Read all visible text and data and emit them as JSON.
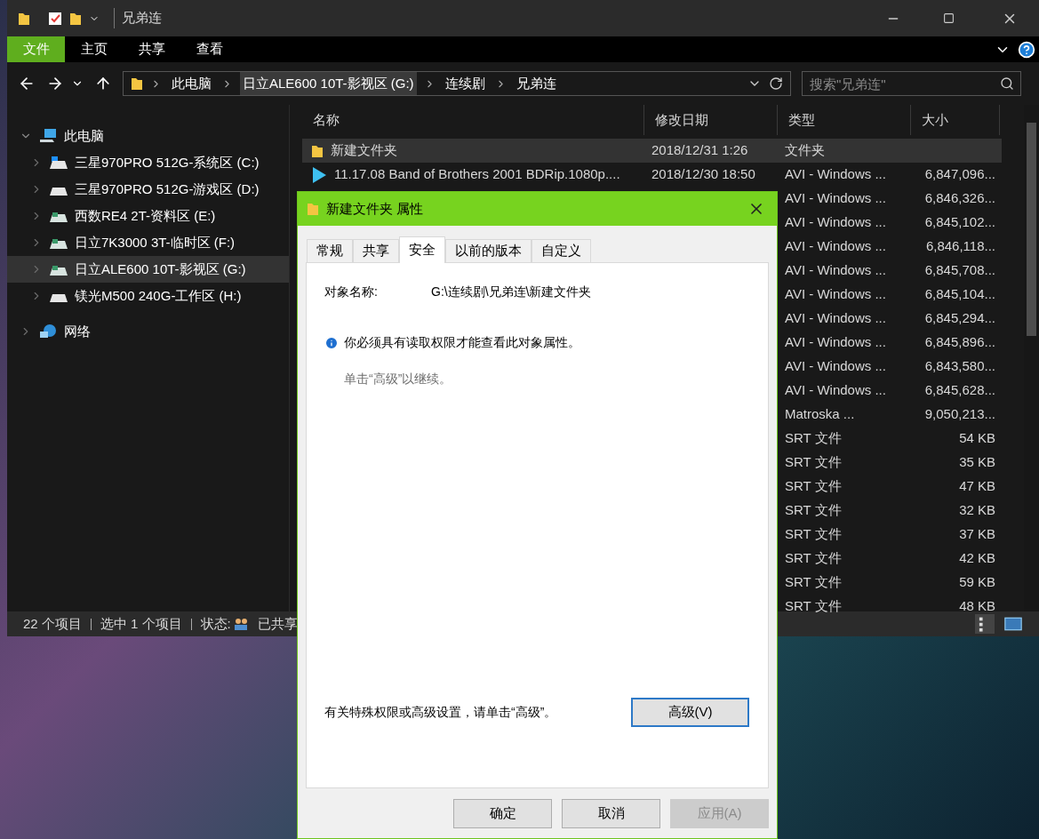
{
  "explorer": {
    "title": "兄弟连",
    "ribbon_tabs": [
      {
        "label": "文件",
        "selected": true
      },
      {
        "label": "主页",
        "selected": false
      },
      {
        "label": "共享",
        "selected": false
      },
      {
        "label": "查看",
        "selected": false
      }
    ],
    "breadcrumb": [
      {
        "label": "此电脑",
        "selected": false
      },
      {
        "label": "日立ALE600 10T-影视区 (G:)",
        "selected": true
      },
      {
        "label": "连续剧",
        "selected": false
      },
      {
        "label": "兄弟连",
        "selected": false
      }
    ],
    "search": {
      "placeholder": "搜索\"兄弟连\""
    },
    "nav": [
      {
        "label": "此电脑",
        "kind": "pc",
        "expanded": true,
        "selected": false,
        "children": [
          {
            "label": "三星970PRO 512G-系统区 (C:)",
            "kind": "system-drive",
            "selected": false
          },
          {
            "label": "三星970PRO 512G-游戏区 (D:)",
            "kind": "ssd",
            "selected": false
          },
          {
            "label": "西数RE4 2T-资料区 (E:)",
            "kind": "hdd",
            "selected": false
          },
          {
            "label": "日立7K3000 3T-临时区 (F:)",
            "kind": "hdd",
            "selected": false
          },
          {
            "label": "日立ALE600 10T-影视区 (G:)",
            "kind": "hdd",
            "selected": true
          },
          {
            "label": "镁光M500 240G-工作区 (H:)",
            "kind": "ssd",
            "selected": false
          }
        ]
      },
      {
        "label": "网络",
        "kind": "network",
        "expanded": false,
        "selected": false
      }
    ],
    "columns": [
      "名称",
      "修改日期",
      "类型",
      "大小"
    ],
    "rows": [
      {
        "kind": "folder",
        "name": "新建文件夹",
        "date": "2018/12/31 1:26",
        "type": "文件夹",
        "selected": true
      },
      {
        "kind": "video",
        "name": "11.17.08 Band of Brothers 2001 BDRip.1080p....",
        "date": "2018/12/30 18:50",
        "type": "AVI - Windows ...",
        "size": "6,847,096...",
        "selected": false
      },
      {
        "type": "AVI - Windows ...",
        "size": "6,846,326...",
        "selected": false
      },
      {
        "type": "AVI - Windows ...",
        "size": "6,845,102...",
        "selected": false
      },
      {
        "type": "AVI - Windows ...",
        "size": "6,846,118...",
        "selected": false
      },
      {
        "type": "AVI - Windows ...",
        "size": "6,845,708...",
        "selected": false
      },
      {
        "type": "AVI - Windows ...",
        "size": "6,845,104...",
        "selected": false
      },
      {
        "type": "AVI - Windows ...",
        "size": "6,845,294...",
        "selected": false
      },
      {
        "type": "AVI - Windows ...",
        "size": "6,845,896...",
        "selected": false
      },
      {
        "type": "AVI - Windows ...",
        "size": "6,843,580...",
        "selected": false
      },
      {
        "type": "AVI - Windows ...",
        "size": "6,845,628...",
        "selected": false
      },
      {
        "type": "Matroska ...",
        "size": "9,050,213...",
        "selected": false
      },
      {
        "type": "SRT 文件",
        "size": "54 KB",
        "selected": false
      },
      {
        "type": "SRT 文件",
        "size": "35 KB",
        "selected": false
      },
      {
        "type": "SRT 文件",
        "size": "47 KB",
        "selected": false
      },
      {
        "type": "SRT 文件",
        "size": "32 KB",
        "selected": false
      },
      {
        "type": "SRT 文件",
        "size": "37 KB",
        "selected": false
      },
      {
        "type": "SRT 文件",
        "size": "42 KB",
        "selected": false
      },
      {
        "type": "SRT 文件",
        "size": "59 KB",
        "selected": false
      },
      {
        "type": "SRT 文件",
        "size": "48 KB",
        "selected": false
      }
    ],
    "status": [
      "22 个项目",
      "选中 1 个项目",
      "状态:",
      "已共享"
    ]
  },
  "dialog": {
    "title": "新建文件夹 属性",
    "tabs": [
      {
        "label": "常规",
        "selected": false
      },
      {
        "label": "共享",
        "selected": false
      },
      {
        "label": "安全",
        "selected": true
      },
      {
        "label": "以前的版本",
        "selected": false
      },
      {
        "label": "自定义",
        "selected": false
      }
    ],
    "object_label": "对象名称:",
    "object_value": "G:\\连续剧\\兄弟连\\新建文件夹",
    "notice": "你必须具有读取权限才能查看此对象属性。",
    "hint": "单击“高级”以继续。",
    "advanced_text": "有关特殊权限或高级设置，请单击“高级”。",
    "advanced_button": "高级(V)",
    "buttons": [
      {
        "label": "确定",
        "disabled": false
      },
      {
        "label": "取消",
        "disabled": false
      },
      {
        "label": "应用(A)",
        "disabled": true
      }
    ]
  }
}
